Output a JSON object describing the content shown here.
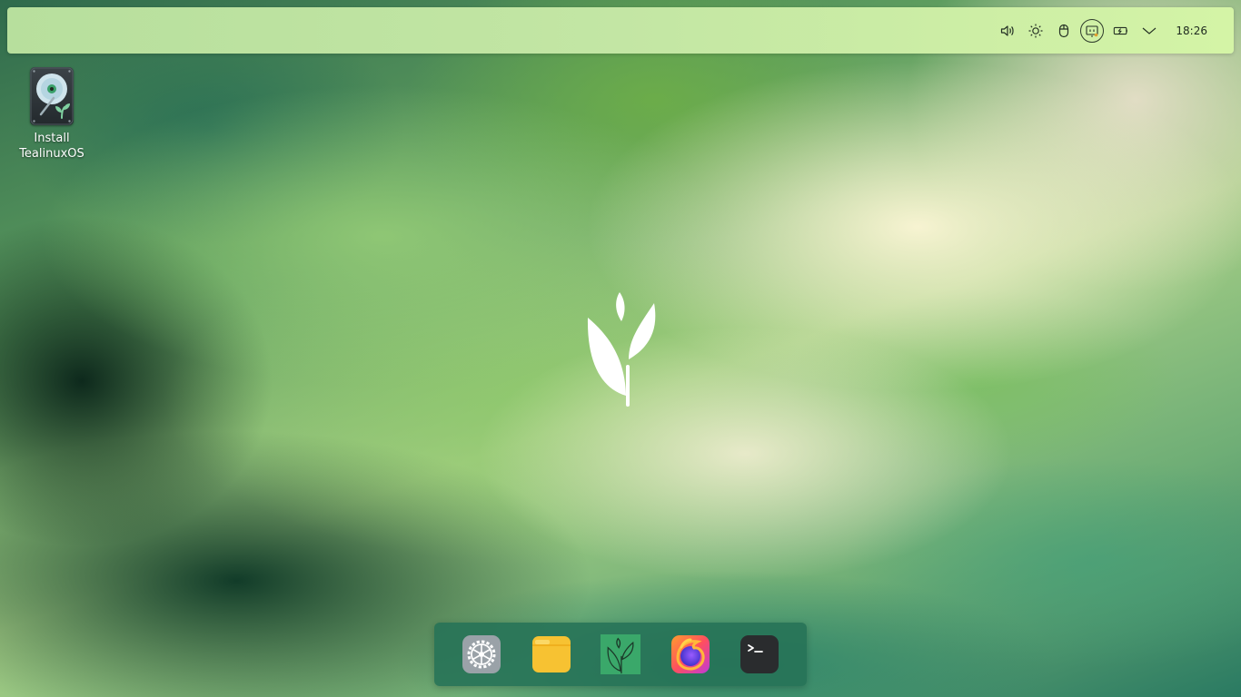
{
  "panel": {
    "tray_icons": [
      "speaker-icon",
      "brightness-icon",
      "mouse-icon",
      "tealinux-update-icon",
      "battery-charging-icon",
      "chevron-down-icon"
    ],
    "clock": "18:26"
  },
  "desktop": {
    "icons": [
      {
        "label": "Install\nTealinuxOS",
        "icon": "installer-disk-icon"
      }
    ]
  },
  "center_logo": "tealinux-leaf-logo",
  "dock": {
    "items": [
      {
        "name": "system-settings",
        "icon": "gear-icon"
      },
      {
        "name": "files",
        "icon": "folder-icon"
      },
      {
        "name": "tealinux-app",
        "icon": "tealinux-leaf-icon"
      },
      {
        "name": "firefox",
        "icon": "firefox-icon"
      },
      {
        "name": "terminal",
        "icon": "terminal-icon"
      }
    ]
  },
  "colors": {
    "panel": "#c3e6a4",
    "dock": "#267256",
    "accent": "#3aa06a"
  }
}
